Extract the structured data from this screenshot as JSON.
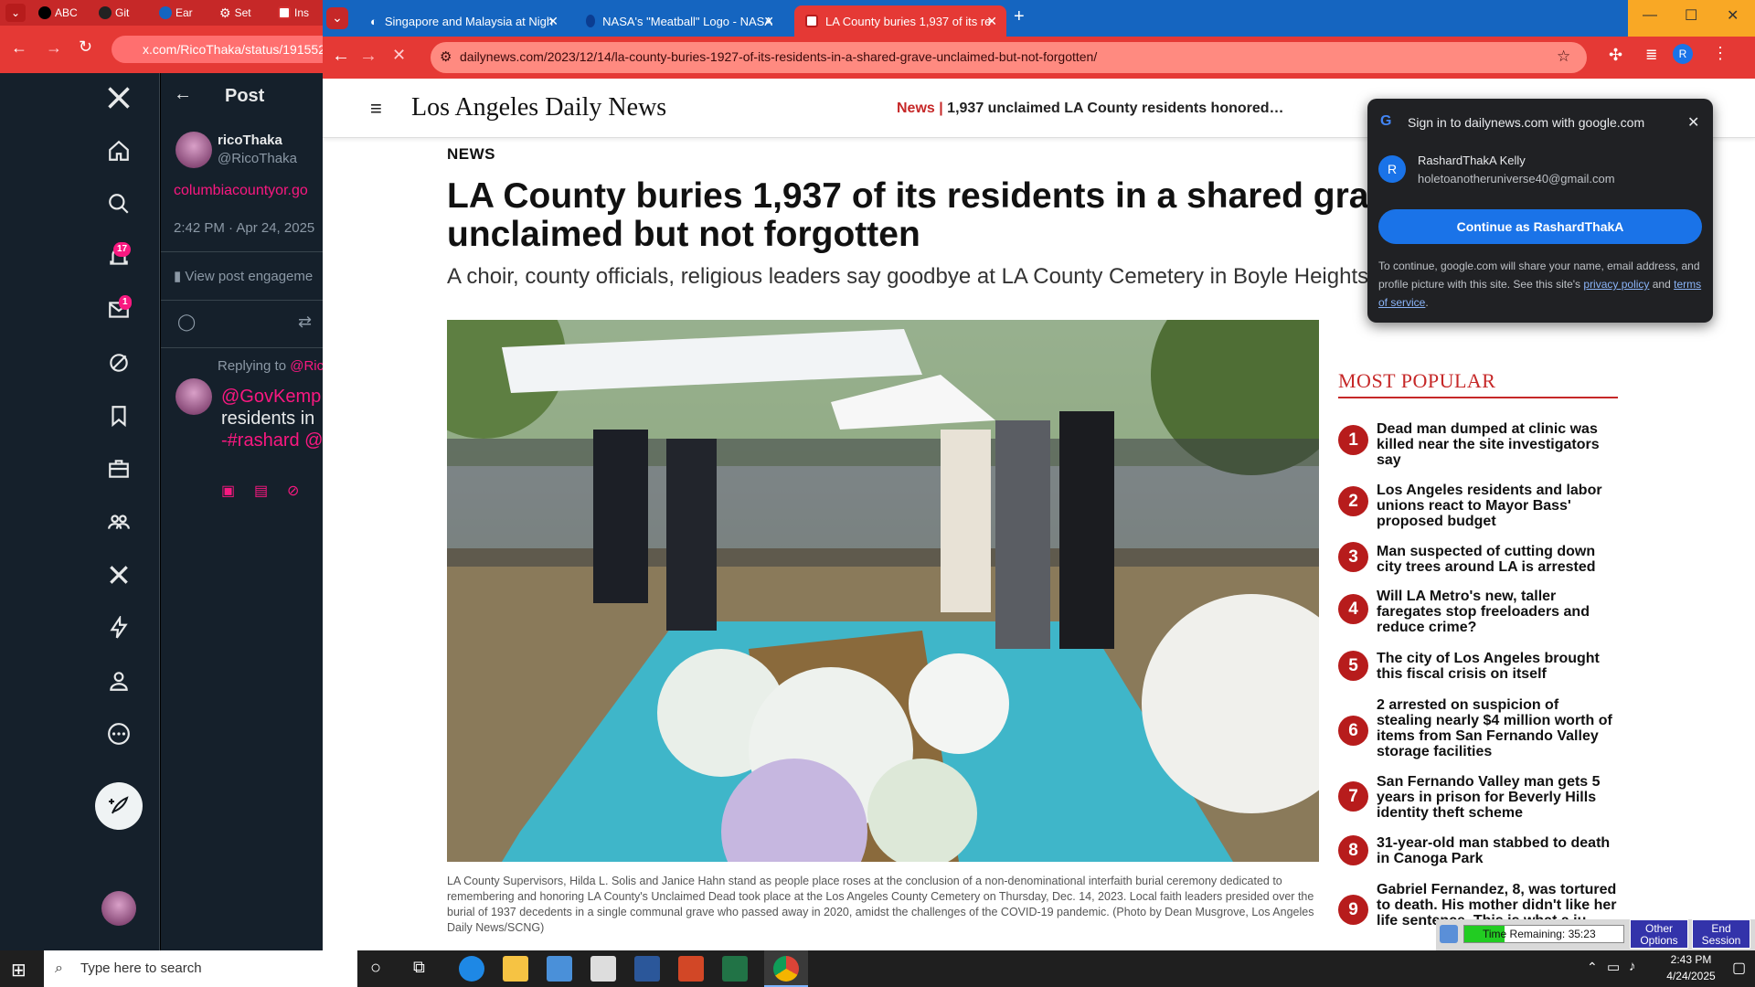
{
  "back_window": {
    "tabs": [
      {
        "label": "ABC"
      },
      {
        "label": "Git"
      },
      {
        "label": "Ear"
      },
      {
        "label": "Set"
      },
      {
        "label": "Ins"
      }
    ],
    "url": "x.com/RicoThaka/status/191552",
    "nav_badges": {
      "notifications": "17",
      "messages": "1"
    },
    "post": {
      "header": "Post",
      "display_name": "ricoThaka",
      "handle": "@RicoThaka",
      "link": "columbiacountyor.go",
      "timestamp": "2:42 PM · Apr 24, 2025",
      "engagements": "View post engageme",
      "replying_to_label": "Replying to ",
      "replying_to_handle": "@Ric",
      "reply_line1": "@GovKemp",
      "reply_line2": "residents in",
      "reply_line3": "-#rashard @"
    }
  },
  "browser": {
    "tabs": [
      {
        "label": "Singapore and Malaysia at Nigh",
        "close": "✕"
      },
      {
        "label": "NASA's \"Meatball\" Logo - NASA",
        "close": "✕"
      },
      {
        "label": "LA County buries 1,937 of its re",
        "close": "✕"
      }
    ],
    "new_tab": "+",
    "url": "dailynews.com/2023/12/14/la-county-buries-1927-of-its-residents-in-a-shared-grave-unclaimed-but-not-forgotten/",
    "profile_initial": "R"
  },
  "article": {
    "site_name": "Los Angeles Daily News",
    "ticker_label": "News",
    "ticker_sep": " | ",
    "ticker_text": "1,937 unclaimed LA County residents honored…",
    "section": "NEWS",
    "headline": "LA County buries 1,937 of its residents in a shared grave, unclaimed but not forgotten",
    "subhead": "A choir, county officials, religious leaders say goodbye at LA County Cemetery in Boyle Heights",
    "caption": "LA County Supervisors, Hilda L. Solis and Janice Hahn stand as people place roses at the conclusion of a non-denominational interfaith burial ceremony dedicated to remembering and honoring LA County's Unclaimed Dead took place at the Los Angeles County Cemetery on Thursday, Dec. 14, 2023. Local faith leaders presided over the burial of 1937 decedents in a single communal grave who passed away in 2020, amidst the challenges of the COVID-19 pandemic. (Photo by Dean Musgrove, Los Angeles Daily News/SCNG)"
  },
  "most_popular": {
    "heading": "MOST POPULAR",
    "items": [
      {
        "num": "1",
        "title": "Dead man dumped at clinic was killed near the site investigators say"
      },
      {
        "num": "2",
        "title": "Los Angeles residents and labor unions react to Mayor Bass' proposed budget"
      },
      {
        "num": "3",
        "title": "Man suspected of cutting down city trees around LA is arrested"
      },
      {
        "num": "4",
        "title": "Will LA Metro's new, taller faregates stop freeloaders and reduce crime?"
      },
      {
        "num": "5",
        "title": "The city of Los Angeles brought this fiscal crisis on itself"
      },
      {
        "num": "6",
        "title": "2 arrested on suspicion of stealing nearly $4 million worth of items from San Fernando Valley storage facilities"
      },
      {
        "num": "7",
        "title": "San Fernando Valley man gets 5 years in prison for Beverly Hills identity theft scheme"
      },
      {
        "num": "8",
        "title": "31-year-old man stabbed to death in Canoga Park"
      },
      {
        "num": "9",
        "title": "Gabriel Fernandez, 8, was tortured to death. His mother didn't like her life sentence. This is what a ju"
      }
    ]
  },
  "google_signin": {
    "title": "Sign in to dailynews.com with google.com",
    "avatar_initial": "R",
    "account_name": "RashardThakA Kelly",
    "account_email": "holetoanotheruniverse40@gmail.com",
    "continue_label": "Continue as RashardThakA",
    "note_prefix": "To continue, google.com will share your name, email address, and profile picture with this site. See this site's ",
    "privacy_link": "privacy policy",
    "note_and": " and ",
    "terms_link": "terms of service",
    "note_end": "."
  },
  "session_timer": {
    "label": "Time Remaining: 35:23",
    "remaining_fraction": 0.25,
    "other_options": "Other Options",
    "end_session": "End Session"
  },
  "taskbar": {
    "search_placeholder": "Type here to search",
    "time": "2:43 PM",
    "date": "4/24/2025"
  },
  "colors": {
    "browser_tabbar": "#1565c0",
    "browser_toolbar": "#e53935",
    "accent_red": "#c62828",
    "x_background": "#15202b",
    "x_pink": "#f91880",
    "google_blue": "#1a73e8"
  }
}
